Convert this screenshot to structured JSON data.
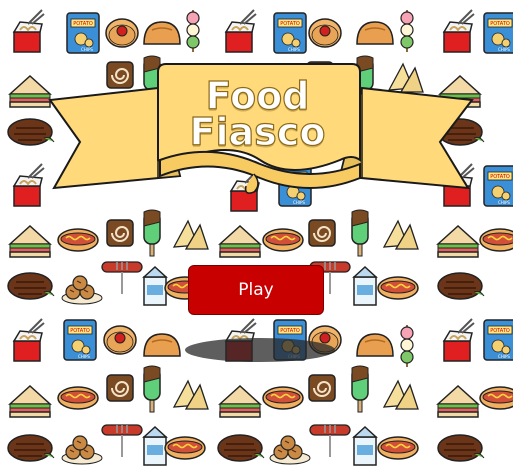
{
  "game": {
    "title_line1": "Food",
    "title_line2": "Fiasco",
    "play_label": "Play"
  },
  "colors": {
    "banner": "#ffd97a",
    "banner_outline": "#1a1a1a",
    "play_button": "#c80000",
    "title_text": "#ffffff"
  },
  "background_items": [
    "noodles-box",
    "potato-chips-bag",
    "jam-cookie",
    "bun",
    "dango",
    "sandwich",
    "swiss-roll",
    "popsicle",
    "nachos",
    "steak",
    "hot-dog",
    "sausage-fork",
    "milk-carton",
    "takoyaki"
  ],
  "chip_bag_text": [
    "POTATO",
    "CHIPS"
  ]
}
